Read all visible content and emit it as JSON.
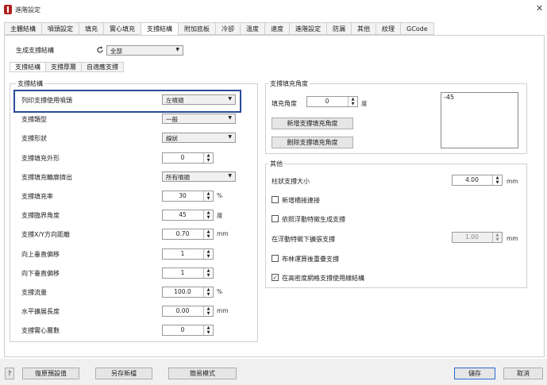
{
  "window": {
    "title": "進階設定",
    "close_symbol": "✕"
  },
  "main_tabs": [
    "主體結構",
    "噴頭設定",
    "填充",
    "實心填充",
    "支撐結構",
    "附加底板",
    "冷卻",
    "溫度",
    "速度",
    "進階設定",
    "防漏",
    "其他",
    "紋理",
    "GCode"
  ],
  "header": {
    "support_mode_label": "生成支撐結構",
    "support_mode_value": "全部"
  },
  "sub_tabs": [
    "支撐結構",
    "支撐厚層",
    "自適應支撐"
  ],
  "support_group": {
    "title": "支撐結構",
    "rows": [
      {
        "label": "列印支撐使用噴頭",
        "type": "select",
        "value": "左噴頭"
      },
      {
        "label": "支撐類型",
        "type": "select",
        "value": "一般"
      },
      {
        "label": "支撐形狀",
        "type": "select",
        "value": "線狀"
      },
      {
        "label": "支撐填充外形",
        "type": "spin",
        "value": "0",
        "unit": ""
      },
      {
        "label": "支撐填充輪廓擠出",
        "type": "select",
        "value": "所有噴頭"
      },
      {
        "label": "支撐填充率",
        "type": "spin",
        "value": "30",
        "unit": "%"
      },
      {
        "label": "支撐臨界角度",
        "type": "spin",
        "value": "45",
        "unit": "度"
      },
      {
        "label": "支撐X/Y方向距離",
        "type": "spin",
        "value": "0.70",
        "unit": "mm"
      },
      {
        "label": "向上垂直偏移",
        "type": "spin",
        "value": "1",
        "unit": ""
      },
      {
        "label": "向下垂直偏移",
        "type": "spin",
        "value": "1",
        "unit": ""
      },
      {
        "label": "支撐流量",
        "type": "spin",
        "value": "100.0",
        "unit": "%"
      },
      {
        "label": "水平擴展長度",
        "type": "spin",
        "value": "0.00",
        "unit": "mm"
      },
      {
        "label": "支撐實心層數",
        "type": "spin",
        "value": "0",
        "unit": ""
      }
    ]
  },
  "fill_angle_group": {
    "title": "支撐填充角度",
    "angle_label": "填充角度",
    "angle_value": "0",
    "angle_unit": "度",
    "add_button": "新增支撐填充角度",
    "delete_button": "刪除支撐填充角度",
    "angle_list": [
      "-45"
    ]
  },
  "other_group": {
    "title": "其他",
    "pillar_label": "柱狀支撐大小",
    "pillar_value": "4.00",
    "pillar_unit": "mm",
    "check_add_bridge": {
      "label": "新增橋接連接",
      "checked": false
    },
    "check_float": {
      "label": "依照浮動特徵生成支撐",
      "checked": false
    },
    "float_expand_label": "在浮動特徵下擴張支撐",
    "float_expand_value": "1.00",
    "float_expand_unit": "mm",
    "check_boolean": {
      "label": "布林運算後重疊支撐",
      "checked": false
    },
    "check_dense": {
      "label": "在高密度網格支撐使用線結構",
      "checked": true
    }
  },
  "footer": {
    "help": "?",
    "reset": "復原預設值",
    "save_new": "另存新檔",
    "easy_mode": "簡易模式",
    "save": "儲存",
    "cancel": "取消"
  }
}
